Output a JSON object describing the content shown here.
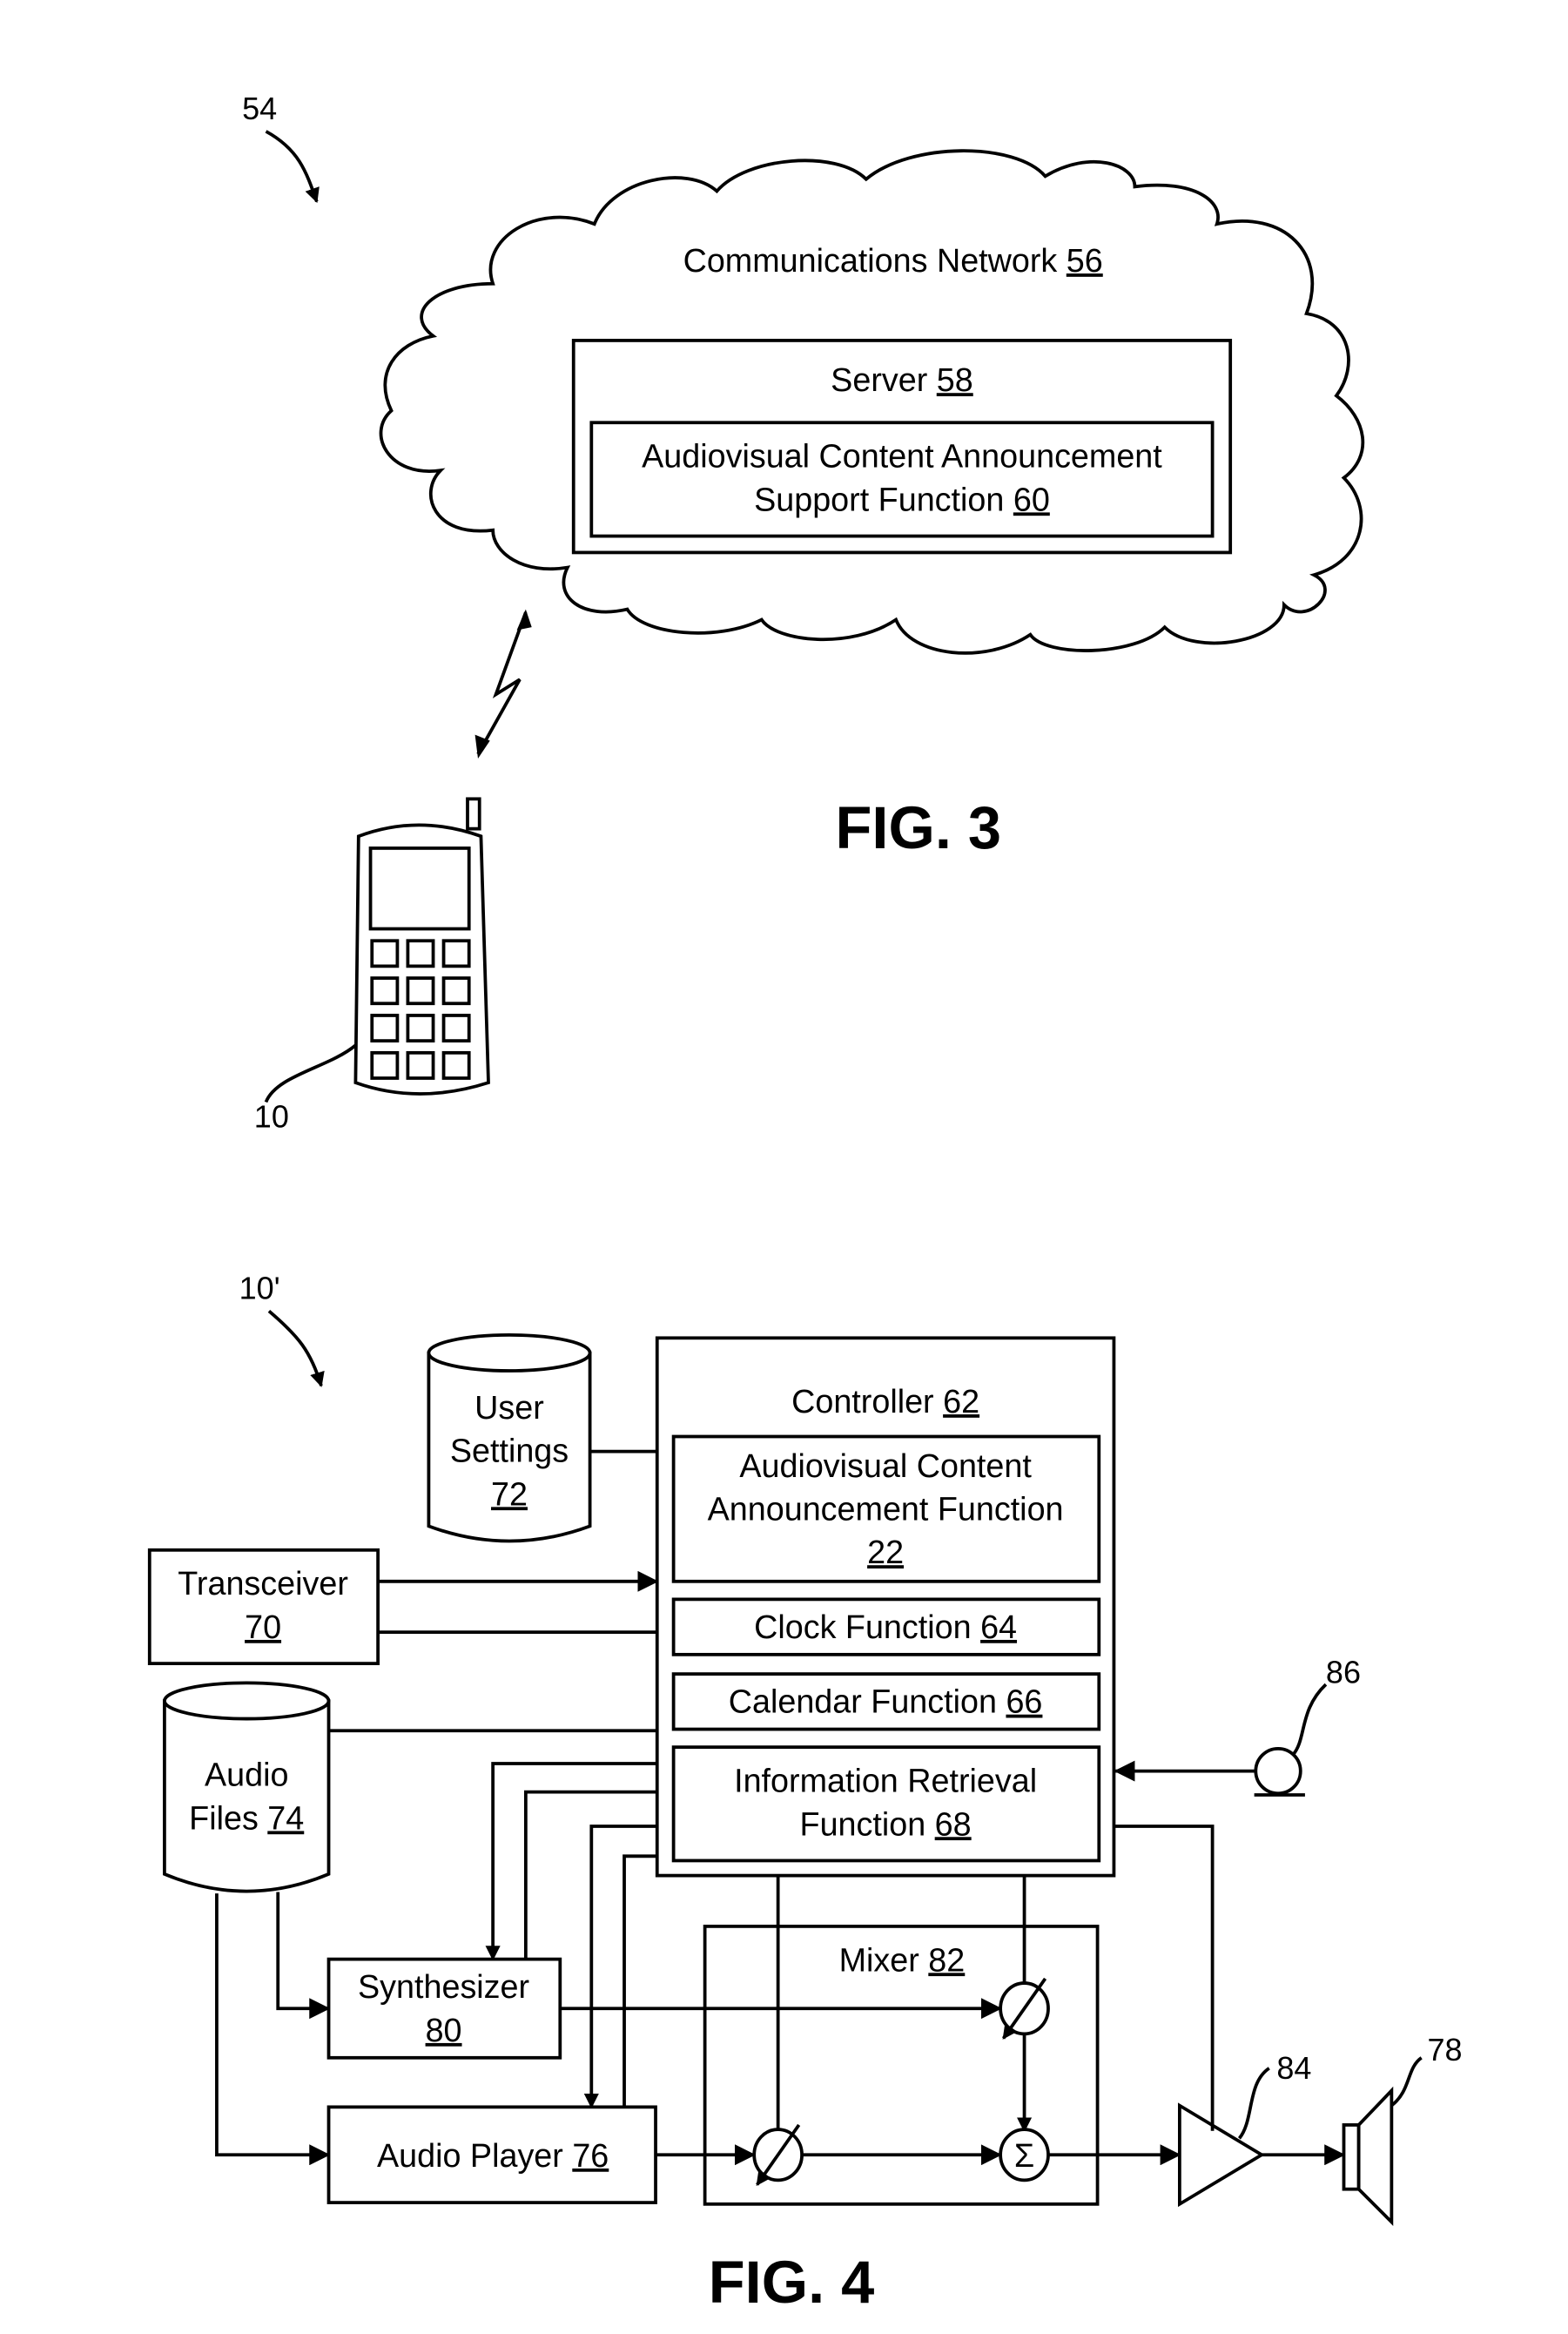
{
  "fig3": {
    "title": "FIG. 3",
    "ref_system": "54",
    "network": {
      "label": "Communications Network ",
      "num": "56"
    },
    "server": {
      "label": "Server ",
      "num": "58"
    },
    "support_fn": {
      "line1": "Audiovisual Content Announcement",
      "line2": "Support Function ",
      "num": "60"
    },
    "phone_ref": "10"
  },
  "fig4": {
    "title": "FIG. 4",
    "ref_device": "10'",
    "controller": {
      "label": "Controller ",
      "num": "62"
    },
    "acaf": {
      "line1": "Audiovisual Content",
      "line2": "Announcement Function",
      "num": "22"
    },
    "clock": {
      "label": "Clock Function ",
      "num": "64"
    },
    "calendar": {
      "label": "Calendar Function ",
      "num": "66"
    },
    "info": {
      "line1": "Information Retrieval",
      "line2": "Function ",
      "num": "68"
    },
    "user_settings": {
      "line1": "User",
      "line2": "Settings",
      "num": "72"
    },
    "transceiver": {
      "label": "Transceiver",
      "num": "70"
    },
    "audio_files": {
      "line1": "Audio",
      "line2": "Files ",
      "num": "74"
    },
    "synth": {
      "label": "Synthesizer",
      "num": "80"
    },
    "player": {
      "label": "Audio Player ",
      "num": "76"
    },
    "mixer": {
      "label": "Mixer ",
      "num": "82"
    },
    "sum_symbol": "Σ",
    "amp_ref": "84",
    "speaker_ref": "78",
    "mic_ref": "86"
  }
}
